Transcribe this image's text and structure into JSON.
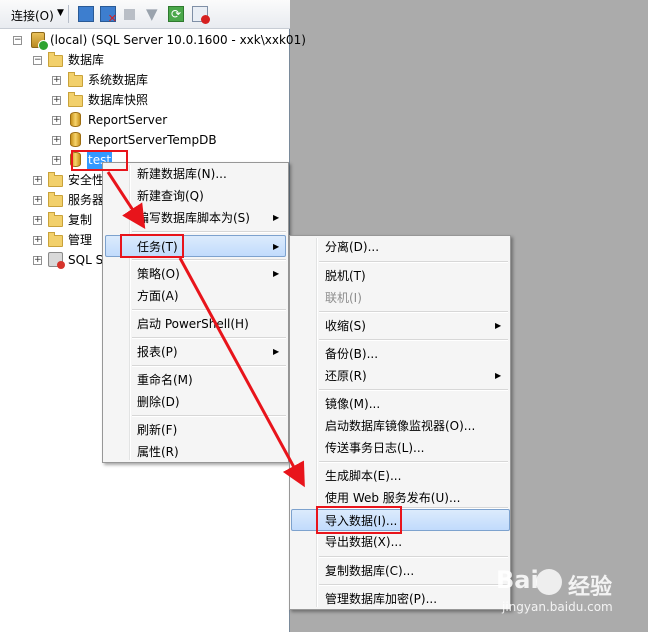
{
  "toolbar": {
    "connect_label": "连接(O)",
    "icons": [
      "connect-icon",
      "disconnect-icon",
      "stop-icon",
      "filter-icon",
      "refresh-icon",
      "summary-icon"
    ]
  },
  "tree": {
    "server": "(local) (SQL Server 10.0.1600 - xxk\\xxk01)",
    "databases": "数据库",
    "system_databases": "系统数据库",
    "snapshots": "数据库快照",
    "report_server": "ReportServer",
    "report_server_temp": "ReportServerTempDB",
    "test_db": "test",
    "security": "安全性",
    "server_objects": "服务器对象",
    "replication": "复制",
    "management": "管理",
    "agent": "SQL Server 代理"
  },
  "context_menu": {
    "new_database": "新建数据库(N)...",
    "new_query": "新建查询(Q)",
    "script_as": "编写数据库脚本为(S)",
    "tasks": "任务(T)",
    "policies": "策略(O)",
    "facets": "方面(A)",
    "powershell": "启动 PowerShell(H)",
    "reports": "报表(P)",
    "rename": "重命名(M)",
    "delete": "删除(D)",
    "refresh": "刷新(F)",
    "properties": "属性(R)"
  },
  "tasks_menu": {
    "detach": "分离(D)...",
    "take_offline": "脱机(T)",
    "bring_online": "联机(I)",
    "shrink": "收缩(S)",
    "backup": "备份(B)...",
    "restore": "还原(R)",
    "mirror": "镜像(M)...",
    "mirror_monitor": "启动数据库镜像监视器(O)...",
    "log_shipping": "传送事务日志(L)...",
    "generate_scripts": "生成脚本(E)...",
    "publish_web": "使用 Web 服务发布(U)...",
    "import_data": "导入数据(I)...",
    "export_data": "导出数据(X)...",
    "copy_database": "复制数据库(C)...",
    "manage_encryption": "管理数据库加密(P)..."
  },
  "watermark": {
    "brand": "Bai",
    "cn": "经验",
    "url": "jingyan.baidu.com"
  },
  "colors": {
    "annotation": "#e8141b",
    "selection": "#3399ff",
    "highlight": "#c1dbfc",
    "background": "#ababab"
  }
}
